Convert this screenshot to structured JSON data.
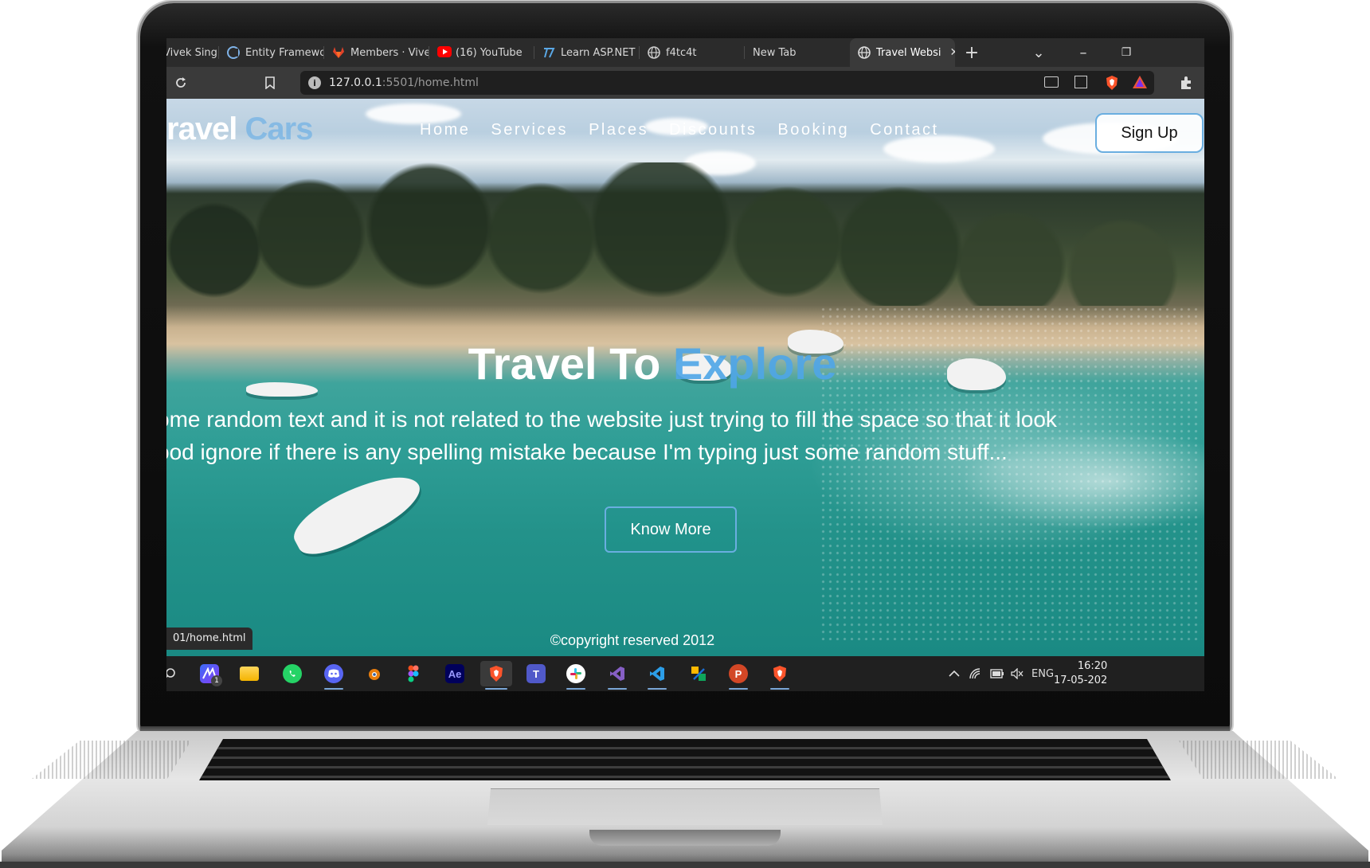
{
  "browser": {
    "tabs": [
      {
        "label": "Vivek Sing",
        "icon": "page-icon"
      },
      {
        "label": "Entity Framework",
        "icon": "ef-icon"
      },
      {
        "label": "Members · Vivek",
        "icon": "gitlab-icon"
      },
      {
        "label": "(16) YouTube",
        "icon": "youtube-icon"
      },
      {
        "label": "Learn ASP.NET W",
        "icon": "asp-icon"
      },
      {
        "label": "f4tc4t",
        "icon": "globe-icon"
      },
      {
        "label": "New Tab",
        "icon": ""
      },
      {
        "label": "Travel Websi",
        "icon": "globe-icon",
        "active": true
      }
    ],
    "new_tab": "+",
    "tab_list": "⌄",
    "minimize": "–",
    "restore": "❐",
    "url_host": "127.0.0.1",
    "url_rest": ":5501/home.html",
    "status_url": "01/home.html"
  },
  "site": {
    "logo_main": "ravel",
    "logo_accent": " Cars",
    "nav": [
      "Home",
      "Services",
      "Places",
      "Discounts",
      "Booking",
      "Contact"
    ],
    "signup": "Sign Up",
    "hero_title_main": "Travel To ",
    "hero_title_accent": "Explore",
    "hero_line1": "ome random text and it is not related to the website just trying to fill the space so that it look",
    "hero_line2": "ood ignore if there is any spelling mistake because I'm typing just some random stuff...",
    "cta": "Know More",
    "copyright": "©copyright reserved 2012"
  },
  "taskbar": {
    "apps": [
      "search-icon",
      "tasks-icon",
      "file-explorer-icon",
      "whatsapp-icon",
      "discord-icon",
      "blender-icon",
      "figma-icon",
      "after-effects-icon",
      "brave-icon",
      "teams-icon",
      "slack-icon",
      "visual-studio-icon",
      "vscode-icon",
      "snip-icon",
      "powerpoint-icon",
      "brave-icon"
    ],
    "badge": "1",
    "ae_label": "Ae",
    "ppt_label": "P",
    "lang": "ENG",
    "time": "16:20",
    "date": "17-05-202"
  },
  "colors": {
    "accent": "#4fa6e8",
    "button_border": "#6aaee0",
    "taskbar": "#202020",
    "tabbar": "#2b2b2b"
  }
}
